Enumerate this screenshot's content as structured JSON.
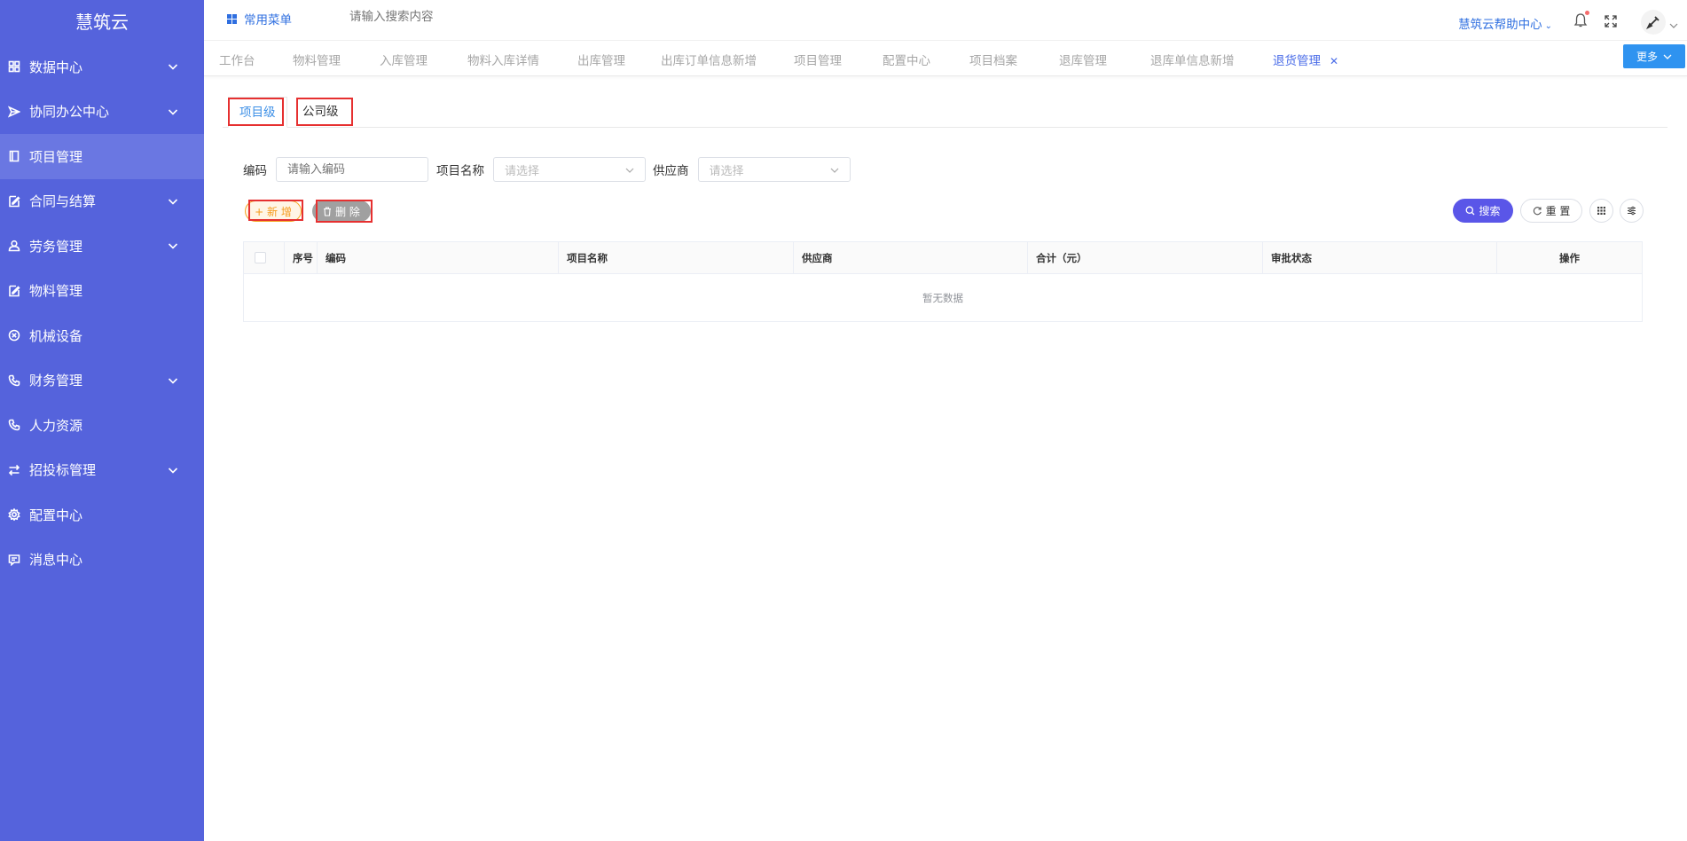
{
  "app": {
    "logo": "慧筑云"
  },
  "sidebar": {
    "items": [
      {
        "label": "数据中心",
        "icon": "grid-icon",
        "chevron": true
      },
      {
        "label": "协同办公中心",
        "icon": "send-icon",
        "chevron": true
      },
      {
        "label": "项目管理",
        "icon": "book-icon",
        "chevron": false,
        "active": true
      },
      {
        "label": "合同与结算",
        "icon": "edit-icon",
        "chevron": true
      },
      {
        "label": "劳务管理",
        "icon": "user-icon",
        "chevron": true
      },
      {
        "label": "物料管理",
        "icon": "edit-icon",
        "chevron": false
      },
      {
        "label": "机械设备",
        "icon": "circle-x-icon",
        "chevron": false
      },
      {
        "label": "财务管理",
        "icon": "phone-icon",
        "chevron": true
      },
      {
        "label": "人力资源",
        "icon": "phone-icon",
        "chevron": false
      },
      {
        "label": "招投标管理",
        "icon": "swap-icon",
        "chevron": true
      },
      {
        "label": "配置中心",
        "icon": "gear-icon",
        "chevron": false
      },
      {
        "label": "消息中心",
        "icon": "message-icon",
        "chevron": false
      }
    ]
  },
  "header": {
    "quick_menu": "常用菜单",
    "search_placeholder": "请输入搜索内容",
    "help": "慧筑云帮助中心"
  },
  "tabs": {
    "items": [
      "工作台",
      "物料管理",
      "入库管理",
      "物料入库详情",
      "出库管理",
      "出库订单信息新增",
      "项目管理",
      "配置中心",
      "项目档案",
      "退库管理",
      "退库单信息新增",
      "退货管理"
    ],
    "active_index": 11,
    "more": "更多"
  },
  "subtabs": {
    "project_level": "项目级",
    "company_level": "公司级"
  },
  "filters": {
    "code_label": "编码",
    "code_placeholder": "请输入编码",
    "project_label": "项目名称",
    "project_placeholder": "请选择",
    "supplier_label": "供应商",
    "supplier_placeholder": "请选择"
  },
  "actions": {
    "add": "+ 新 增",
    "delete": "删 除",
    "search": "搜索",
    "reset": "重 置"
  },
  "table": {
    "columns": [
      "序号",
      "编码",
      "项目名称",
      "供应商",
      "合计（元）",
      "审批状态",
      "操作"
    ],
    "empty_text": "暂无数据"
  },
  "colors": {
    "sidebar": "#5563dc",
    "primary": "#4a6ce8",
    "search_button": "#5a56e8",
    "highlight": "#e63030"
  }
}
